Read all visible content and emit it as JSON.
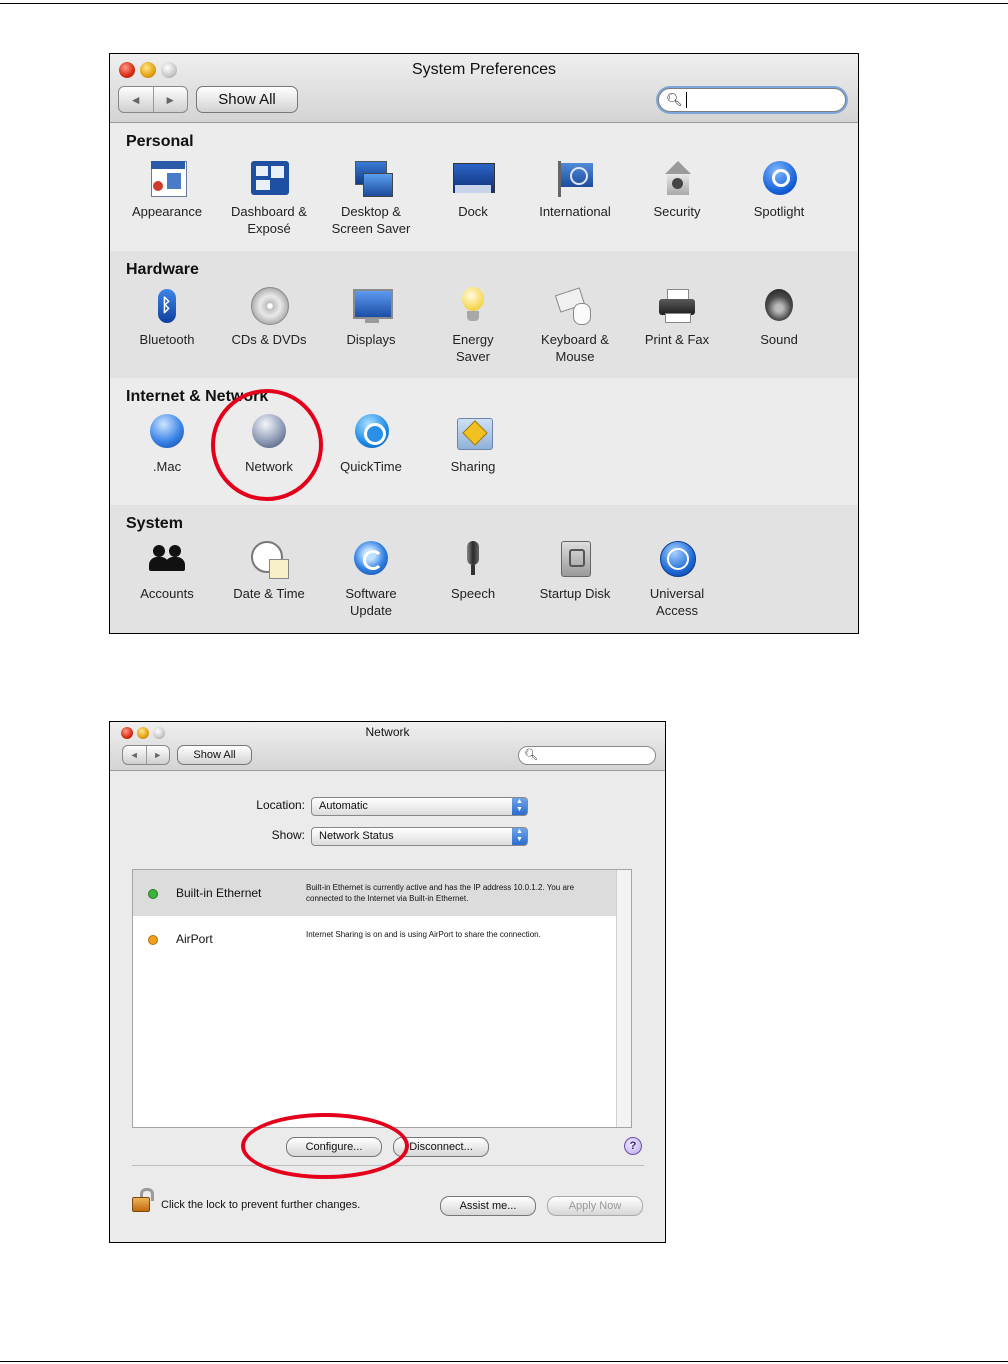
{
  "syspref": {
    "title": "System Preferences",
    "nav_back": "◄",
    "nav_forward": "►",
    "show_all": "Show All",
    "search_placeholder": "",
    "sections": [
      {
        "title": "Personal",
        "items": [
          "Appearance",
          "Dashboard &\nExposé",
          "Desktop &\nScreen Saver",
          "Dock",
          "International",
          "Security",
          "Spotlight"
        ]
      },
      {
        "title": "Hardware",
        "items": [
          "Bluetooth",
          "CDs & DVDs",
          "Displays",
          "Energy\nSaver",
          "Keyboard &\nMouse",
          "Print & Fax",
          "Sound"
        ]
      },
      {
        "title": "Internet & Network",
        "items": [
          ".Mac",
          "Network",
          "QuickTime",
          "Sharing"
        ]
      },
      {
        "title": "System",
        "items": [
          "Accounts",
          "Date & Time",
          "Software\nUpdate",
          "Speech",
          "Startup Disk",
          "Universal\nAccess"
        ]
      }
    ],
    "highlighted_item": "Network",
    "highlight_color": "#e4001b"
  },
  "network": {
    "title": "Network",
    "nav_back": "◄",
    "nav_forward": "►",
    "show_all": "Show All",
    "location_label": "Location:",
    "location_value": "Automatic",
    "show_label": "Show:",
    "show_value": "Network Status",
    "services": [
      {
        "name": "Built-in Ethernet",
        "status_color": "#3cb33a",
        "description": "Built-in Ethernet is currently active and has the IP address 10.0.1.2. You are connected to the Internet via Built-in Ethernet.",
        "selected": true
      },
      {
        "name": "AirPort",
        "status_color": "#f0a020",
        "description": "Internet Sharing is on and is using AirPort to share the connection.",
        "selected": false
      }
    ],
    "configure_button": "Configure...",
    "disconnect_button": "Disconnect...",
    "help_button": "?",
    "lock_text": "Click the lock to prevent further changes.",
    "assist_button": "Assist me...",
    "apply_button": "Apply Now",
    "highlighted_button": "Configure..."
  }
}
